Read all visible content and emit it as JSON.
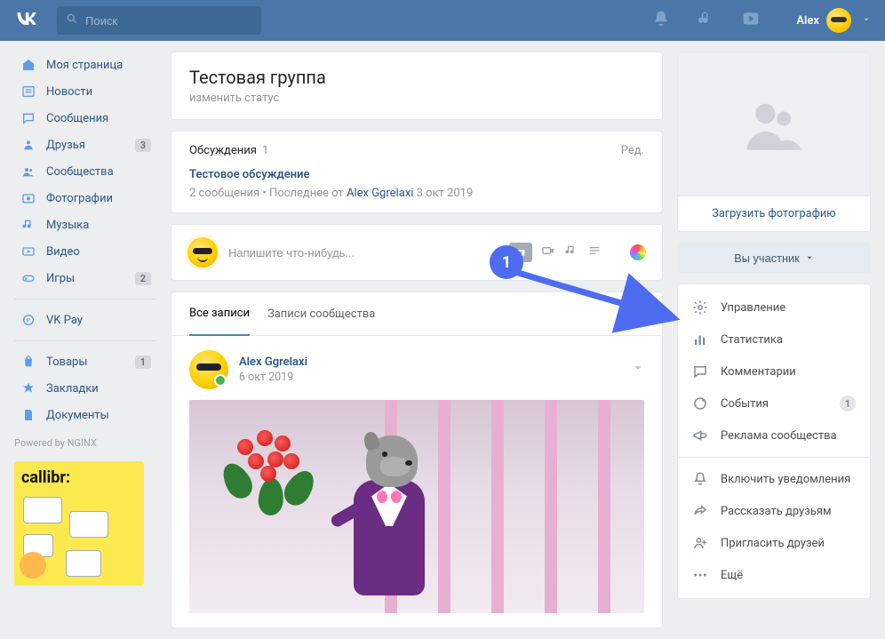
{
  "header": {
    "search_placeholder": "Поиск",
    "user_name": "Alex"
  },
  "nav": {
    "items": [
      {
        "icon": "home",
        "label": "Моя страница",
        "badge": null
      },
      {
        "icon": "news",
        "label": "Новости",
        "badge": null
      },
      {
        "icon": "messages",
        "label": "Сообщения",
        "badge": null
      },
      {
        "icon": "friends",
        "label": "Друзья",
        "badge": "3"
      },
      {
        "icon": "communities",
        "label": "Сообщества",
        "badge": null
      },
      {
        "icon": "photos",
        "label": "Фотографии",
        "badge": null
      },
      {
        "icon": "music",
        "label": "Музыка",
        "badge": null
      },
      {
        "icon": "video",
        "label": "Видео",
        "badge": null
      },
      {
        "icon": "games",
        "label": "Игры",
        "badge": "2"
      }
    ],
    "items2": [
      {
        "icon": "pay",
        "label": "VK Pay",
        "badge": null
      }
    ],
    "items3": [
      {
        "icon": "market",
        "label": "Товары",
        "badge": "1"
      },
      {
        "icon": "bookmarks",
        "label": "Закладки",
        "badge": null
      },
      {
        "icon": "docs",
        "label": "Документы",
        "badge": null
      }
    ],
    "nginx": "Powered by NGINX",
    "ad_brand": "callibr:"
  },
  "group": {
    "title": "Тестовая группа",
    "status_cta": "изменить статус"
  },
  "discussions": {
    "heading": "Обсуждения",
    "count": "1",
    "edit": "Ред.",
    "topic_title": "Тестовое обсуждение",
    "topic_meta_msgs": "2 сообщения",
    "topic_meta_sep": "  •  ",
    "topic_meta_last": "Последнее от ",
    "topic_meta_author": "Alex Ggrelaxi",
    "topic_meta_date": " 3 окт 2019"
  },
  "compose": {
    "placeholder": "Напишите что-нибудь..."
  },
  "tabs": {
    "all": "Все записи",
    "community": "Записи сообщества"
  },
  "post": {
    "author": "Alex Ggrelaxi",
    "date": "6 окт 2019"
  },
  "side": {
    "upload": "Загрузить фотографию",
    "member_btn": "Вы участник",
    "menu1": [
      {
        "icon": "gear",
        "label": "Управление",
        "badge": null
      },
      {
        "icon": "stats",
        "label": "Статистика",
        "badge": null
      },
      {
        "icon": "comments",
        "label": "Комментарии",
        "badge": null
      },
      {
        "icon": "events",
        "label": "События",
        "badge": "1"
      },
      {
        "icon": "ads",
        "label": "Реклама сообщества",
        "badge": null
      }
    ],
    "menu2": [
      {
        "icon": "bell",
        "label": "Включить уведомления",
        "badge": null
      },
      {
        "icon": "share",
        "label": "Рассказать друзьям",
        "badge": null
      },
      {
        "icon": "invite",
        "label": "Пригласить друзей",
        "badge": null
      },
      {
        "icon": "more",
        "label": "Ещё",
        "badge": null
      }
    ]
  },
  "annotation": {
    "step": "1"
  }
}
